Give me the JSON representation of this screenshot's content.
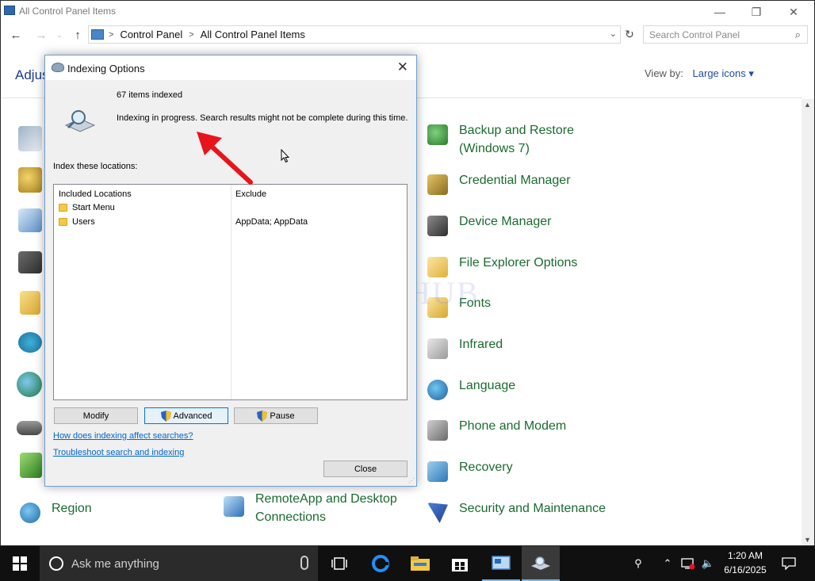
{
  "window": {
    "title": "All Control Panel Items",
    "minimize": "—",
    "maximize": "❐",
    "close": "✕"
  },
  "nav": {
    "back": "←",
    "forward": "→",
    "up": "↑",
    "breadcrumb": [
      "Control Panel",
      "All Control Panel Items"
    ],
    "breadcrumb_sep": ">",
    "search_placeholder": "Search Control Panel"
  },
  "header": {
    "adjust_text": "Adjus",
    "view_by_label": "View by:",
    "view_by_value": "Large icons ▾"
  },
  "items_right": [
    {
      "label": "Backup and Restore (Windows 7)",
      "icon": "backup-icon"
    },
    {
      "label": "Credential Manager",
      "icon": "credential-icon"
    },
    {
      "label": "Device Manager",
      "icon": "device-manager-icon"
    },
    {
      "label": "File Explorer Options",
      "icon": "file-explorer-options-icon"
    },
    {
      "label": "Fonts",
      "icon": "fonts-icon"
    },
    {
      "label": "Infrared",
      "icon": "infrared-icon"
    },
    {
      "label": "Language",
      "icon": "language-icon"
    },
    {
      "label": "Phone and Modem",
      "icon": "phone-modem-icon"
    },
    {
      "label": "Recovery",
      "icon": "recovery-icon"
    },
    {
      "label": "Security and Maintenance",
      "icon": "security-icon"
    }
  ],
  "items_bottom": [
    {
      "label": "Region",
      "icon": "region-icon"
    },
    {
      "label": "RemoteApp and Desktop Connections",
      "icon": "remoteapp-icon"
    }
  ],
  "dialog": {
    "title": "Indexing Options",
    "items_indexed": "67 items indexed",
    "status": "Indexing in progress. Search results might not be complete during this time.",
    "index_locations_label": "Index these locations:",
    "col_included": "Included Locations",
    "col_exclude": "Exclude",
    "locations": [
      {
        "name": "Start Menu",
        "exclude": ""
      },
      {
        "name": "Users",
        "exclude": "AppData; AppData"
      }
    ],
    "btn_modify": "Modify",
    "btn_advanced": "Advanced",
    "btn_pause": "Pause",
    "link_how": "How does indexing affect searches?",
    "link_troubleshoot": "Troubleshoot search and indexing",
    "btn_close": "Close"
  },
  "watermark": "IT Pros HUB",
  "taskbar": {
    "search_text": "Ask me anything",
    "time": "1:20 AM",
    "date": "6/16/2025"
  },
  "colors": {
    "link_green": "#1a6b2f",
    "accent_blue": "#0078d7",
    "annotation_red": "#e8141b"
  }
}
